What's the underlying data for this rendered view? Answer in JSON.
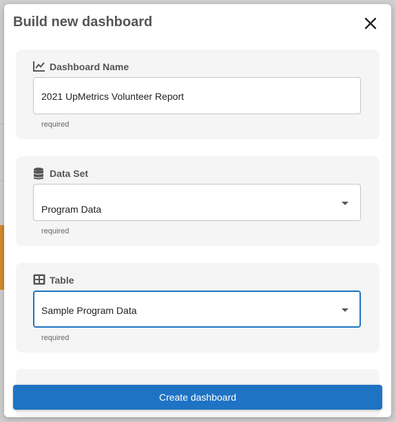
{
  "modal": {
    "title": "Build new dashboard"
  },
  "fields": [
    {
      "label": "Dashboard Name",
      "icon": "line-chart-icon",
      "value": "2021 UpMetrics Volunteer Report",
      "helper": "required",
      "type": "text"
    },
    {
      "label": "Data Set",
      "icon": "database-icon",
      "value": "Program Data",
      "helper": "required",
      "type": "select"
    },
    {
      "label": "Table",
      "icon": "table-icon",
      "value": "Sample Program Data",
      "helper": "required",
      "type": "select"
    }
  ],
  "actions": {
    "create_label": "Create dashboard"
  },
  "colors": {
    "primary": "#1e73c4",
    "card_bg": "#f5f5f5",
    "title": "#555555"
  }
}
